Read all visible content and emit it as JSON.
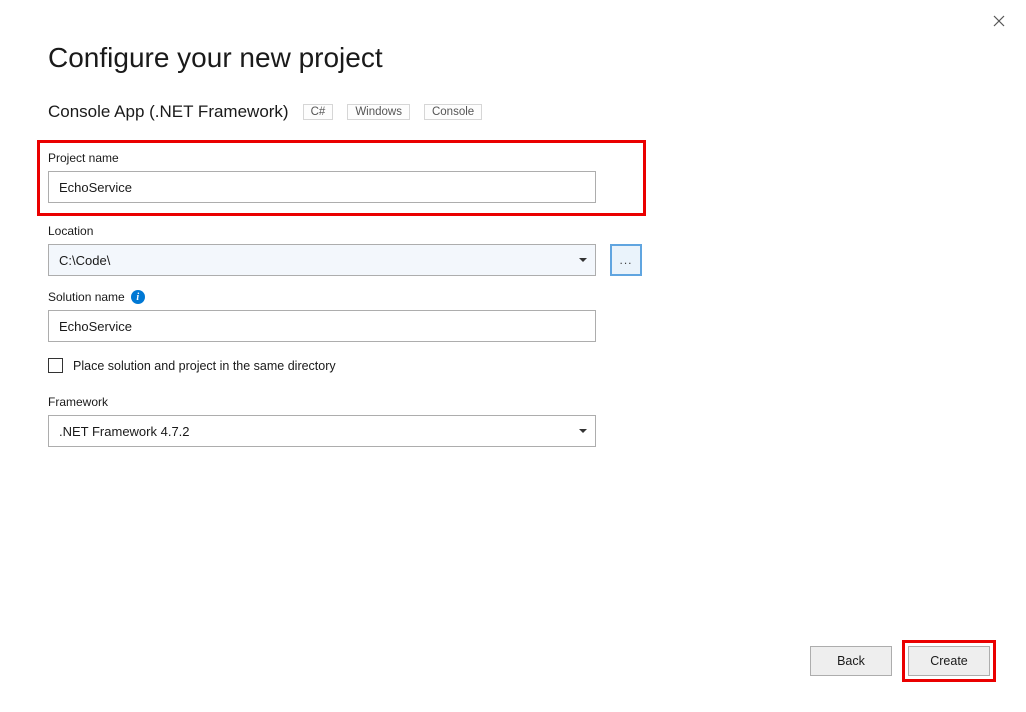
{
  "dialog": {
    "title": "Configure your new project",
    "templateName": "Console App (.NET Framework)",
    "tags": [
      "C#",
      "Windows",
      "Console"
    ]
  },
  "fields": {
    "projectName": {
      "label": "Project name",
      "value": "EchoService"
    },
    "location": {
      "label": "Location",
      "value": "C:\\Code\\",
      "browse": "..."
    },
    "solutionName": {
      "label": "Solution name",
      "value": "EchoService"
    },
    "sameDirectory": {
      "label": "Place solution and project in the same directory",
      "checked": false
    },
    "framework": {
      "label": "Framework",
      "value": ".NET Framework 4.7.2"
    }
  },
  "buttons": {
    "back": "Back",
    "create": "Create"
  }
}
